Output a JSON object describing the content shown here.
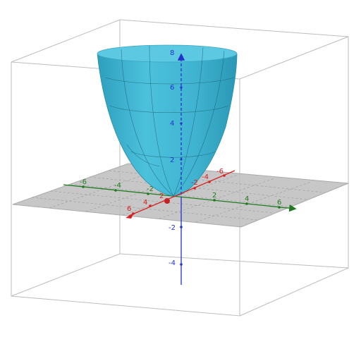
{
  "scene": {
    "surface_color": "#3fb6d3",
    "surface_rim_color": "#5cc8e2",
    "plane_color": "#bdbdbd",
    "box_edge_color": "#bdbdbd"
  },
  "axes": {
    "x": {
      "color": "#1f7a1f",
      "ticks": [
        "-6",
        "-4",
        "-2",
        "2",
        "4",
        "6"
      ]
    },
    "y": {
      "color": "#d62020",
      "ticks": [
        "-6",
        "-4",
        "-2",
        "2",
        "4",
        "6"
      ]
    },
    "z": {
      "color": "#2233cc",
      "ticks": [
        "-4",
        "-2",
        "2",
        "4",
        "6",
        "8"
      ]
    }
  },
  "origin_point_color": "#c82020",
  "icons": [
    "arrowhead-icon"
  ]
}
